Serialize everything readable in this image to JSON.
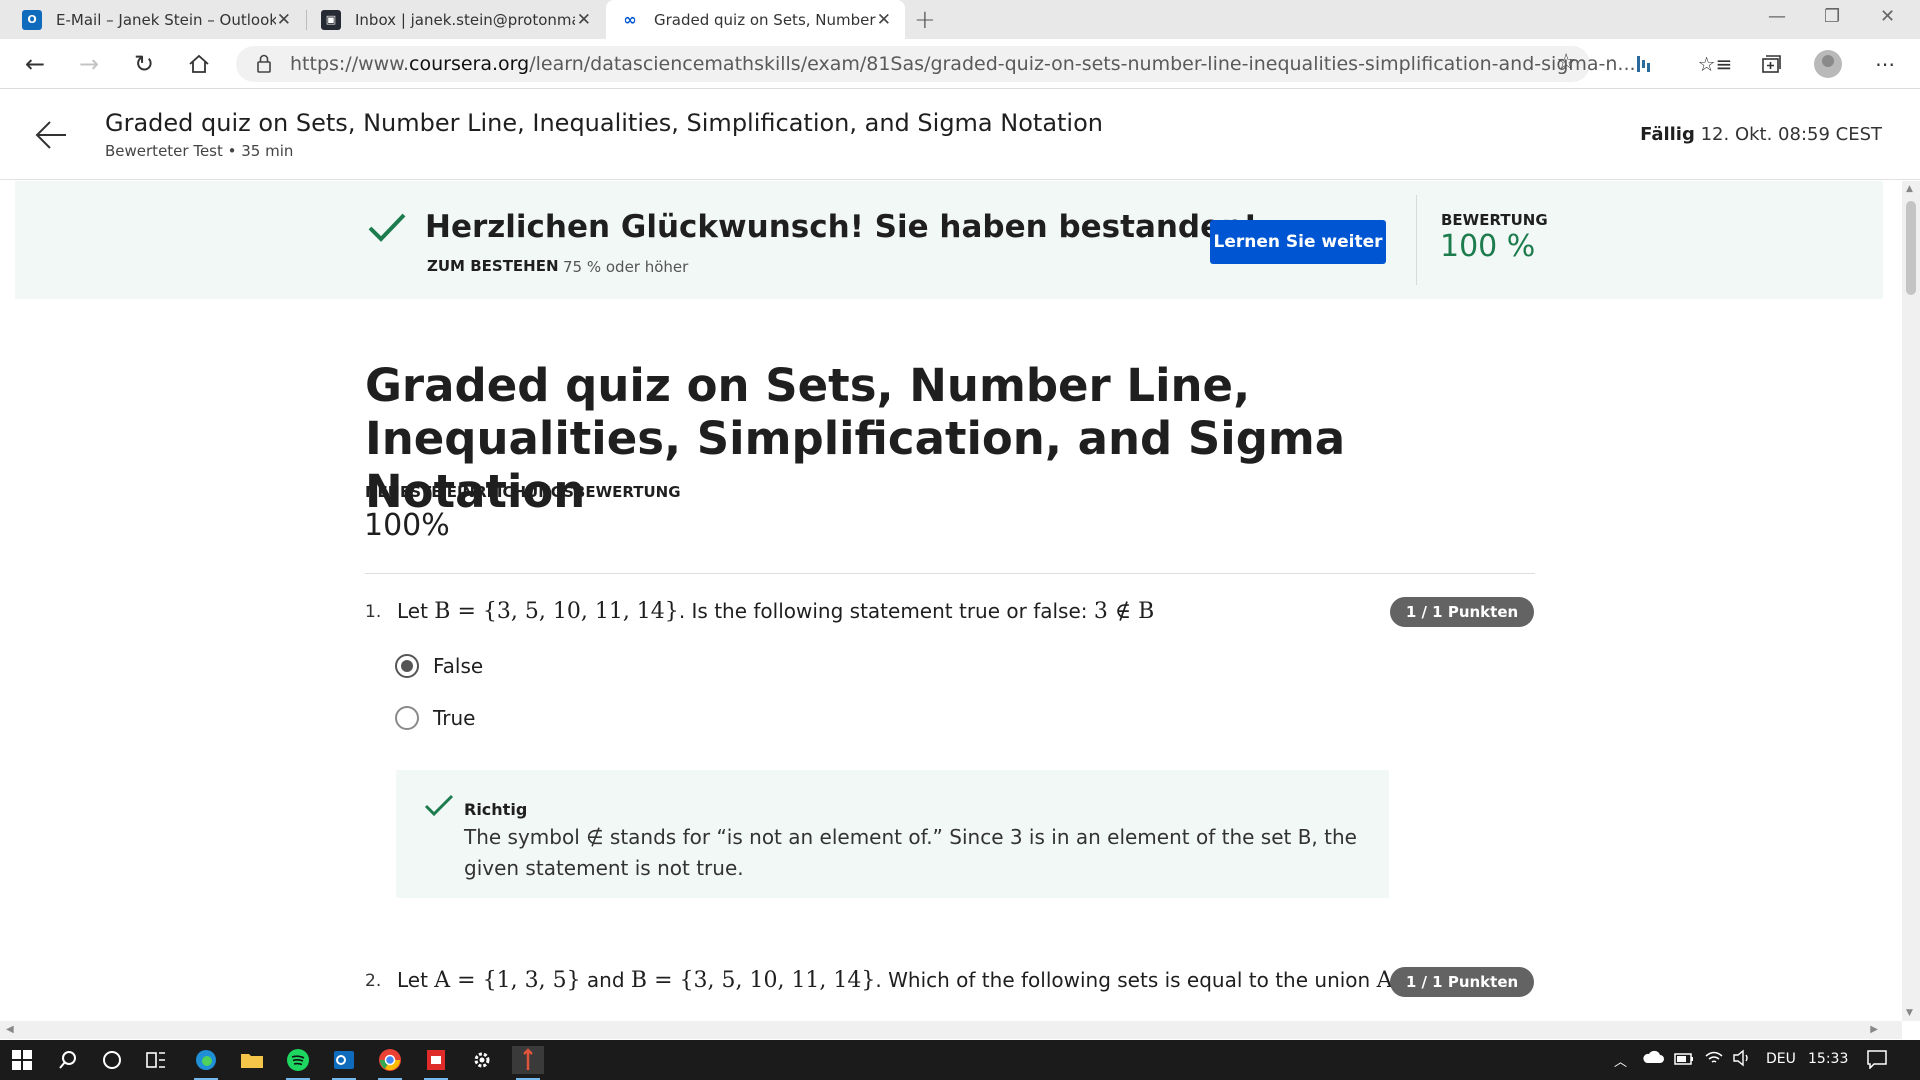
{
  "browser": {
    "tabs": [
      {
        "title": "E-Mail – Janek Stein – Outlook",
        "icon": "outlook-icon"
      },
      {
        "title": "Inbox | janek.stein@protonmail.c",
        "icon": "protonmail-icon"
      },
      {
        "title": "Graded quiz on Sets, Number Lin",
        "icon": "coursera-icon",
        "active": true
      }
    ],
    "url_prefix": "https://www.",
    "url_domain": "coursera.org",
    "url_path": "/learn/datasciencemathskills/exam/81Sas/graded-quiz-on-sets-number-line-inequalities-simplification-and-sigma-n..."
  },
  "header": {
    "title": "Graded quiz on Sets, Number Line, Inequalities, Simplification, and Sigma Notation",
    "subtitle": "Bewerteter Test • 35 min",
    "due_label": "Fällig",
    "due_value": " 12. Okt. 08:59 CEST"
  },
  "banner": {
    "message": "Herzlichen Glückwunsch! Sie haben bestanden!",
    "pass_label": "ZUM BESTEHEN",
    "pass_value": "75 % oder höher",
    "button": "Lernen Sie weiter",
    "grade_label": "BEWERTUNG",
    "grade_value": "100 %",
    "accent_color": "#1d7c4e",
    "button_color": "#0056d2"
  },
  "quiz": {
    "title": "Graded quiz on Sets, Number Line, Inequalities, Simplification, and Sigma Notation",
    "latest_label": "NEUESTE EINREICHUNGSBEWERTUNG",
    "latest_score": "100%",
    "questions": [
      {
        "number": "1.",
        "text_a": "Let ",
        "math_a": "B = {3, 5, 10, 11, 14}",
        "text_b": ". Is the following statement true or false: ",
        "math_b": "3 ∉ B",
        "text_c": "",
        "points": "1 / 1 Punkten",
        "options": [
          {
            "label": "False",
            "selected": true
          },
          {
            "label": "True",
            "selected": false
          }
        ],
        "feedback": {
          "heading": "Richtig",
          "text": "The symbol ∉ stands for “is not an element of.” Since 3 is in an element of the set B, the given statement is not true."
        }
      },
      {
        "number": "2.",
        "text_a": "Let ",
        "math_a": "A = {1, 3, 5}",
        "text_b": " and ",
        "math_b": "B = {3, 5, 10, 11, 14}",
        "text_c": ". Which of the following sets is equal to the union ",
        "math_c": "A ∪ B",
        "text_d": "?",
        "points": "1 / 1 Punkten"
      }
    ]
  },
  "taskbar": {
    "language": "DEU",
    "time": "15:33",
    "apps": [
      "windows-start-icon",
      "search-icon",
      "cortana-icon",
      "task-view-icon",
      "edge-icon",
      "file-explorer-icon",
      "spotify-icon",
      "outlook-icon",
      "chrome-icon",
      "pdf-app-icon",
      "settings-icon",
      "app-icon"
    ]
  }
}
